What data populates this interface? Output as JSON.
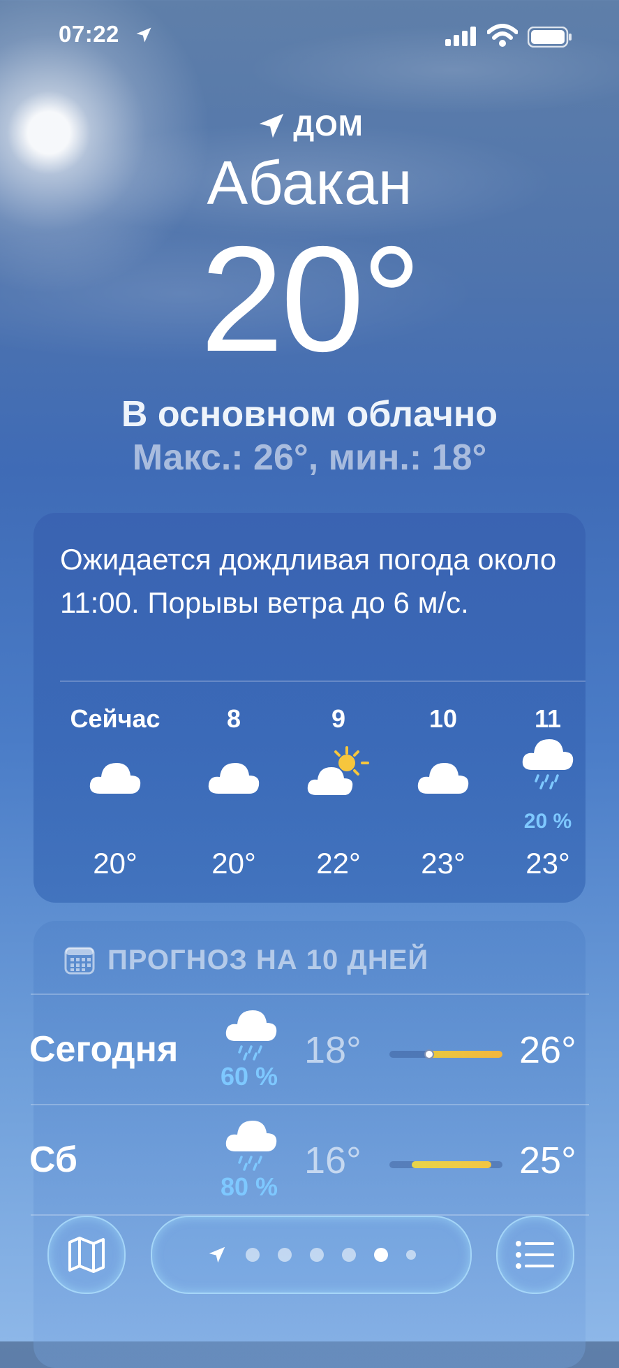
{
  "status_bar": {
    "time": "07:22"
  },
  "header": {
    "location_label": "ДОМ",
    "city": "Абакан",
    "temperature": "20°",
    "condition": "В основном облачно",
    "hi_lo": "Макс.: 26°, мин.: 18°"
  },
  "hourly": {
    "summary": "Ожидается дождливая погода около 11:00. Порывы ветра до 6 м/с.",
    "hours": [
      {
        "label": "Сейчас",
        "icon": "cloud-icon",
        "temp": "20°",
        "pop": ""
      },
      {
        "label": "8",
        "icon": "cloud-icon",
        "temp": "20°",
        "pop": ""
      },
      {
        "label": "9",
        "icon": "partly-sunny-icon",
        "temp": "22°",
        "pop": ""
      },
      {
        "label": "10",
        "icon": "cloud-icon",
        "temp": "23°",
        "pop": ""
      },
      {
        "label": "11",
        "icon": "rain-cloud-icon",
        "temp": "23°",
        "pop": "20 %"
      }
    ]
  },
  "daily": {
    "title": "ПРОГНОЗ НА 10 ДНЕЙ",
    "days": [
      {
        "name": "Сегодня",
        "icon": "rain-cloud-icon",
        "pop": "60 %",
        "min": "18°",
        "max": "26°",
        "range_start": 0.35,
        "range_end": 1.0,
        "current": 0.35
      },
      {
        "name": "Сб",
        "icon": "rain-cloud-icon",
        "pop": "80 %",
        "min": "16°",
        "max": "25°",
        "range_start": 0.2,
        "range_end": 0.9
      }
    ]
  },
  "toolbar": {
    "map_icon": "map-icon",
    "list_icon": "list-icon",
    "pages": 7,
    "active_page": 4
  },
  "colors": {
    "precip": "#7ec8ff",
    "bar_warm": "#f4b63d",
    "bar_yellow": "#f2d34a"
  }
}
